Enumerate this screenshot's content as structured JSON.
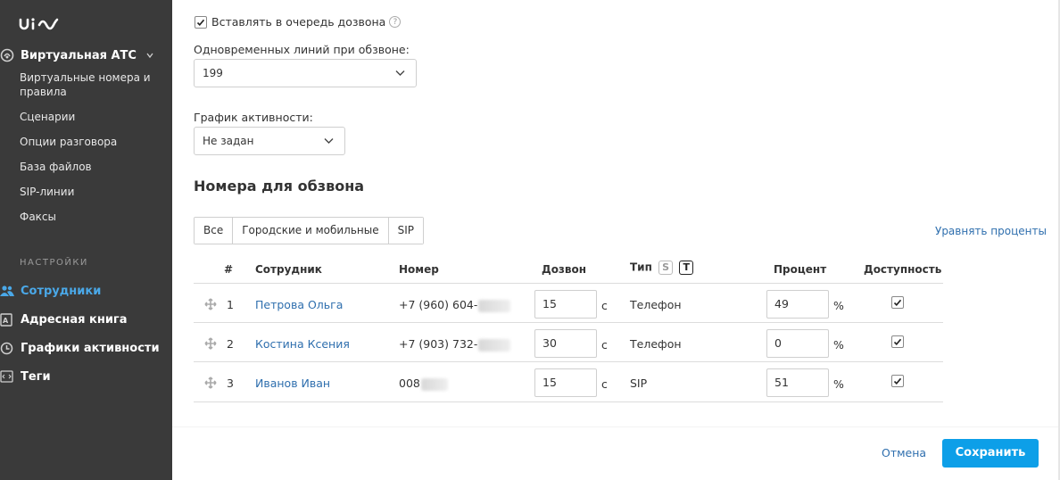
{
  "sidebar": {
    "logo_text": "uis",
    "pbx": {
      "title": "Виртуальная АТС",
      "items": [
        {
          "label": "Виртуальные номера и правила"
        },
        {
          "label": "Сценарии"
        },
        {
          "label": "Опции разговора"
        },
        {
          "label": "База файлов"
        },
        {
          "label": "SIP-линии"
        },
        {
          "label": "Факсы"
        }
      ]
    },
    "settings_label": "НАСТРОЙКИ",
    "settings_items": [
      {
        "label": "Сотрудники",
        "active": true
      },
      {
        "label": "Адресная книга"
      },
      {
        "label": "Графики активности"
      },
      {
        "label": "Теги"
      }
    ]
  },
  "form": {
    "queue_checkbox_label": "Вставлять в очередь дозвона",
    "queue_checked": true,
    "lines_label": "Одновременных линий при обзвоне:",
    "lines_value": "199",
    "schedule_label": "График активности:",
    "schedule_value": "Не задан"
  },
  "numbers": {
    "title": "Номера для обзвона",
    "filters": [
      "Все",
      "Городские и мобильные",
      "SIP"
    ],
    "equalize_link": "Уравнять проценты",
    "columns": {
      "index": "#",
      "employee": "Сотрудник",
      "number": "Номер",
      "dial": "Дозвон",
      "type": "Тип",
      "type_s": "S",
      "type_t": "T",
      "percent": "Процент",
      "availability": "Доступность"
    },
    "rows": [
      {
        "index": "1",
        "employee": "Петрова Ольга",
        "number": "+7 (960) 604-",
        "dial": "15",
        "dial_unit": "с",
        "type": "Телефон",
        "percent": "49",
        "percent_unit": "%",
        "available": true
      },
      {
        "index": "2",
        "employee": "Костина Ксения",
        "number": "+7 (903) 732-",
        "dial": "30",
        "dial_unit": "с",
        "type": "Телефон",
        "percent": "0",
        "percent_unit": "%",
        "available": true
      },
      {
        "index": "3",
        "employee": "Иванов Иван",
        "number": "008",
        "dial": "15",
        "dial_unit": "с",
        "type": "SIP",
        "percent": "51",
        "percent_unit": "%",
        "available": true
      }
    ]
  },
  "footer": {
    "cancel": "Отмена",
    "save": "Сохранить"
  },
  "colors": {
    "sidebar_bg": "#3a3a3a",
    "accent": "#0d9fe8",
    "link": "#2f6fae",
    "active_nav": "#4aa8e8"
  }
}
